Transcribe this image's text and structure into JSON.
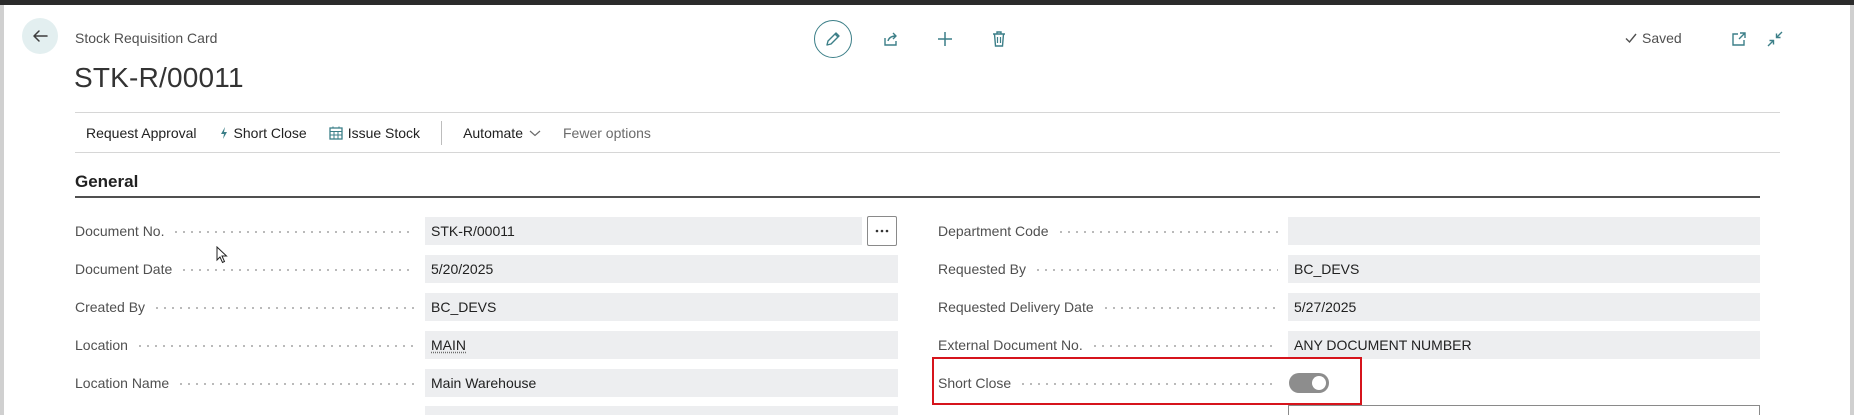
{
  "header": {
    "caption": "Stock Requisition Card",
    "title": "STK-R/00011",
    "status": "Saved"
  },
  "actionbar": {
    "request_approval": "Request Approval",
    "short_close": "Short Close",
    "issue_stock": "Issue Stock",
    "automate": "Automate",
    "fewer_options": "Fewer options"
  },
  "section": {
    "title": "General"
  },
  "left_fields": [
    {
      "label": "Document No.",
      "value": "STK-R/00011"
    },
    {
      "label": "Document Date",
      "value": "5/20/2025"
    },
    {
      "label": "Created By",
      "value": "BC_DEVS"
    },
    {
      "label": "Location",
      "value": "MAIN"
    },
    {
      "label": "Location Name",
      "value": "Main Warehouse"
    }
  ],
  "right_fields": [
    {
      "label": "Department Code",
      "value": ""
    },
    {
      "label": "Requested By",
      "value": "BC_DEVS"
    },
    {
      "label": "Requested Delivery Date",
      "value": "5/27/2025"
    },
    {
      "label": "External Document No.",
      "value": "ANY DOCUMENT NUMBER"
    },
    {
      "label": "Short Close",
      "value": ""
    }
  ],
  "short_close_toggle": {
    "on": true
  },
  "colors": {
    "accent": "#3c7f88",
    "highlight": "#d6141c",
    "field_bg": "#edeef0"
  },
  "icons": {
    "back": "back-arrow-icon",
    "edit": "pencil-icon",
    "share": "share-icon",
    "new": "plus-icon",
    "delete": "trash-icon",
    "saved": "checkmark-icon",
    "open_new_window": "open-new-window-icon",
    "collapse": "collapse-icon",
    "short_close": "lightning-icon",
    "issue_stock": "calendar-grid-icon",
    "automate": "chevron-down-icon",
    "assist": "ellipsis-icon"
  }
}
